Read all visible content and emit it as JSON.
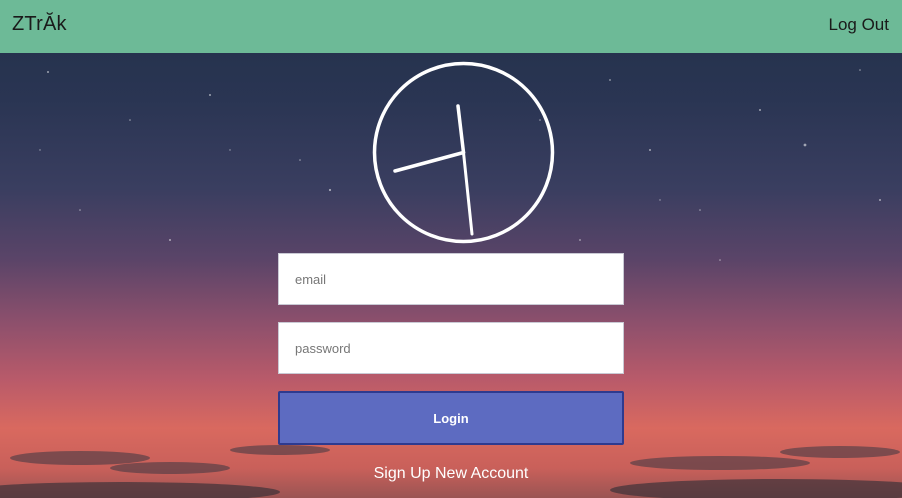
{
  "navbar": {
    "brand": "ZTrĂk",
    "logout_label": "Log Out",
    "background_color": "#6dba97"
  },
  "clock": {
    "icon": "clock-icon",
    "hour_hand_time": "7:45-ish",
    "color": "#ffffff"
  },
  "login_form": {
    "email_placeholder": "email",
    "email_value": "",
    "password_placeholder": "password",
    "password_value": "",
    "login_label": "Login",
    "login_color": "#5d6bc1"
  },
  "signup": {
    "label": "Sign Up New Account"
  }
}
